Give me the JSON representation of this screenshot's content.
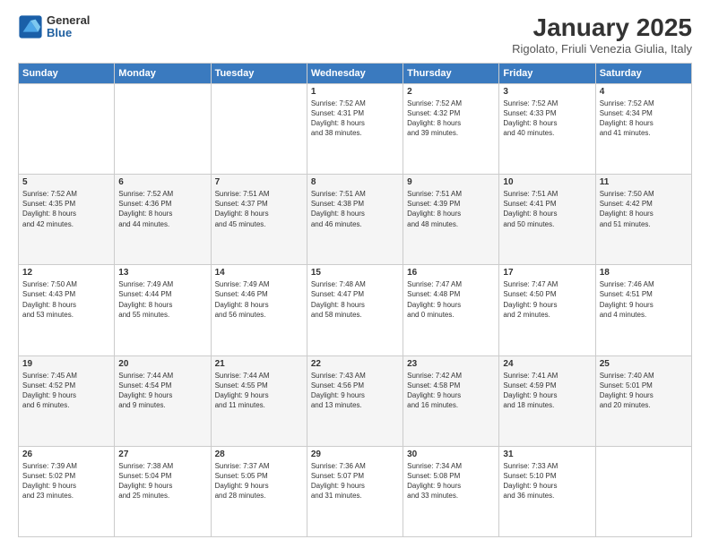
{
  "header": {
    "logo_general": "General",
    "logo_blue": "Blue",
    "title": "January 2025",
    "subtitle": "Rigolato, Friuli Venezia Giulia, Italy"
  },
  "columns": [
    "Sunday",
    "Monday",
    "Tuesday",
    "Wednesday",
    "Thursday",
    "Friday",
    "Saturday"
  ],
  "weeks": [
    {
      "days": [
        {
          "number": "",
          "content": ""
        },
        {
          "number": "",
          "content": ""
        },
        {
          "number": "",
          "content": ""
        },
        {
          "number": "1",
          "content": "Sunrise: 7:52 AM\nSunset: 4:31 PM\nDaylight: 8 hours\nand 38 minutes."
        },
        {
          "number": "2",
          "content": "Sunrise: 7:52 AM\nSunset: 4:32 PM\nDaylight: 8 hours\nand 39 minutes."
        },
        {
          "number": "3",
          "content": "Sunrise: 7:52 AM\nSunset: 4:33 PM\nDaylight: 8 hours\nand 40 minutes."
        },
        {
          "number": "4",
          "content": "Sunrise: 7:52 AM\nSunset: 4:34 PM\nDaylight: 8 hours\nand 41 minutes."
        }
      ]
    },
    {
      "days": [
        {
          "number": "5",
          "content": "Sunrise: 7:52 AM\nSunset: 4:35 PM\nDaylight: 8 hours\nand 42 minutes."
        },
        {
          "number": "6",
          "content": "Sunrise: 7:52 AM\nSunset: 4:36 PM\nDaylight: 8 hours\nand 44 minutes."
        },
        {
          "number": "7",
          "content": "Sunrise: 7:51 AM\nSunset: 4:37 PM\nDaylight: 8 hours\nand 45 minutes."
        },
        {
          "number": "8",
          "content": "Sunrise: 7:51 AM\nSunset: 4:38 PM\nDaylight: 8 hours\nand 46 minutes."
        },
        {
          "number": "9",
          "content": "Sunrise: 7:51 AM\nSunset: 4:39 PM\nDaylight: 8 hours\nand 48 minutes."
        },
        {
          "number": "10",
          "content": "Sunrise: 7:51 AM\nSunset: 4:41 PM\nDaylight: 8 hours\nand 50 minutes."
        },
        {
          "number": "11",
          "content": "Sunrise: 7:50 AM\nSunset: 4:42 PM\nDaylight: 8 hours\nand 51 minutes."
        }
      ]
    },
    {
      "days": [
        {
          "number": "12",
          "content": "Sunrise: 7:50 AM\nSunset: 4:43 PM\nDaylight: 8 hours\nand 53 minutes."
        },
        {
          "number": "13",
          "content": "Sunrise: 7:49 AM\nSunset: 4:44 PM\nDaylight: 8 hours\nand 55 minutes."
        },
        {
          "number": "14",
          "content": "Sunrise: 7:49 AM\nSunset: 4:46 PM\nDaylight: 8 hours\nand 56 minutes."
        },
        {
          "number": "15",
          "content": "Sunrise: 7:48 AM\nSunset: 4:47 PM\nDaylight: 8 hours\nand 58 minutes."
        },
        {
          "number": "16",
          "content": "Sunrise: 7:47 AM\nSunset: 4:48 PM\nDaylight: 9 hours\nand 0 minutes."
        },
        {
          "number": "17",
          "content": "Sunrise: 7:47 AM\nSunset: 4:50 PM\nDaylight: 9 hours\nand 2 minutes."
        },
        {
          "number": "18",
          "content": "Sunrise: 7:46 AM\nSunset: 4:51 PM\nDaylight: 9 hours\nand 4 minutes."
        }
      ]
    },
    {
      "days": [
        {
          "number": "19",
          "content": "Sunrise: 7:45 AM\nSunset: 4:52 PM\nDaylight: 9 hours\nand 6 minutes."
        },
        {
          "number": "20",
          "content": "Sunrise: 7:44 AM\nSunset: 4:54 PM\nDaylight: 9 hours\nand 9 minutes."
        },
        {
          "number": "21",
          "content": "Sunrise: 7:44 AM\nSunset: 4:55 PM\nDaylight: 9 hours\nand 11 minutes."
        },
        {
          "number": "22",
          "content": "Sunrise: 7:43 AM\nSunset: 4:56 PM\nDaylight: 9 hours\nand 13 minutes."
        },
        {
          "number": "23",
          "content": "Sunrise: 7:42 AM\nSunset: 4:58 PM\nDaylight: 9 hours\nand 16 minutes."
        },
        {
          "number": "24",
          "content": "Sunrise: 7:41 AM\nSunset: 4:59 PM\nDaylight: 9 hours\nand 18 minutes."
        },
        {
          "number": "25",
          "content": "Sunrise: 7:40 AM\nSunset: 5:01 PM\nDaylight: 9 hours\nand 20 minutes."
        }
      ]
    },
    {
      "days": [
        {
          "number": "26",
          "content": "Sunrise: 7:39 AM\nSunset: 5:02 PM\nDaylight: 9 hours\nand 23 minutes."
        },
        {
          "number": "27",
          "content": "Sunrise: 7:38 AM\nSunset: 5:04 PM\nDaylight: 9 hours\nand 25 minutes."
        },
        {
          "number": "28",
          "content": "Sunrise: 7:37 AM\nSunset: 5:05 PM\nDaylight: 9 hours\nand 28 minutes."
        },
        {
          "number": "29",
          "content": "Sunrise: 7:36 AM\nSunset: 5:07 PM\nDaylight: 9 hours\nand 31 minutes."
        },
        {
          "number": "30",
          "content": "Sunrise: 7:34 AM\nSunset: 5:08 PM\nDaylight: 9 hours\nand 33 minutes."
        },
        {
          "number": "31",
          "content": "Sunrise: 7:33 AM\nSunset: 5:10 PM\nDaylight: 9 hours\nand 36 minutes."
        },
        {
          "number": "",
          "content": ""
        }
      ]
    }
  ]
}
